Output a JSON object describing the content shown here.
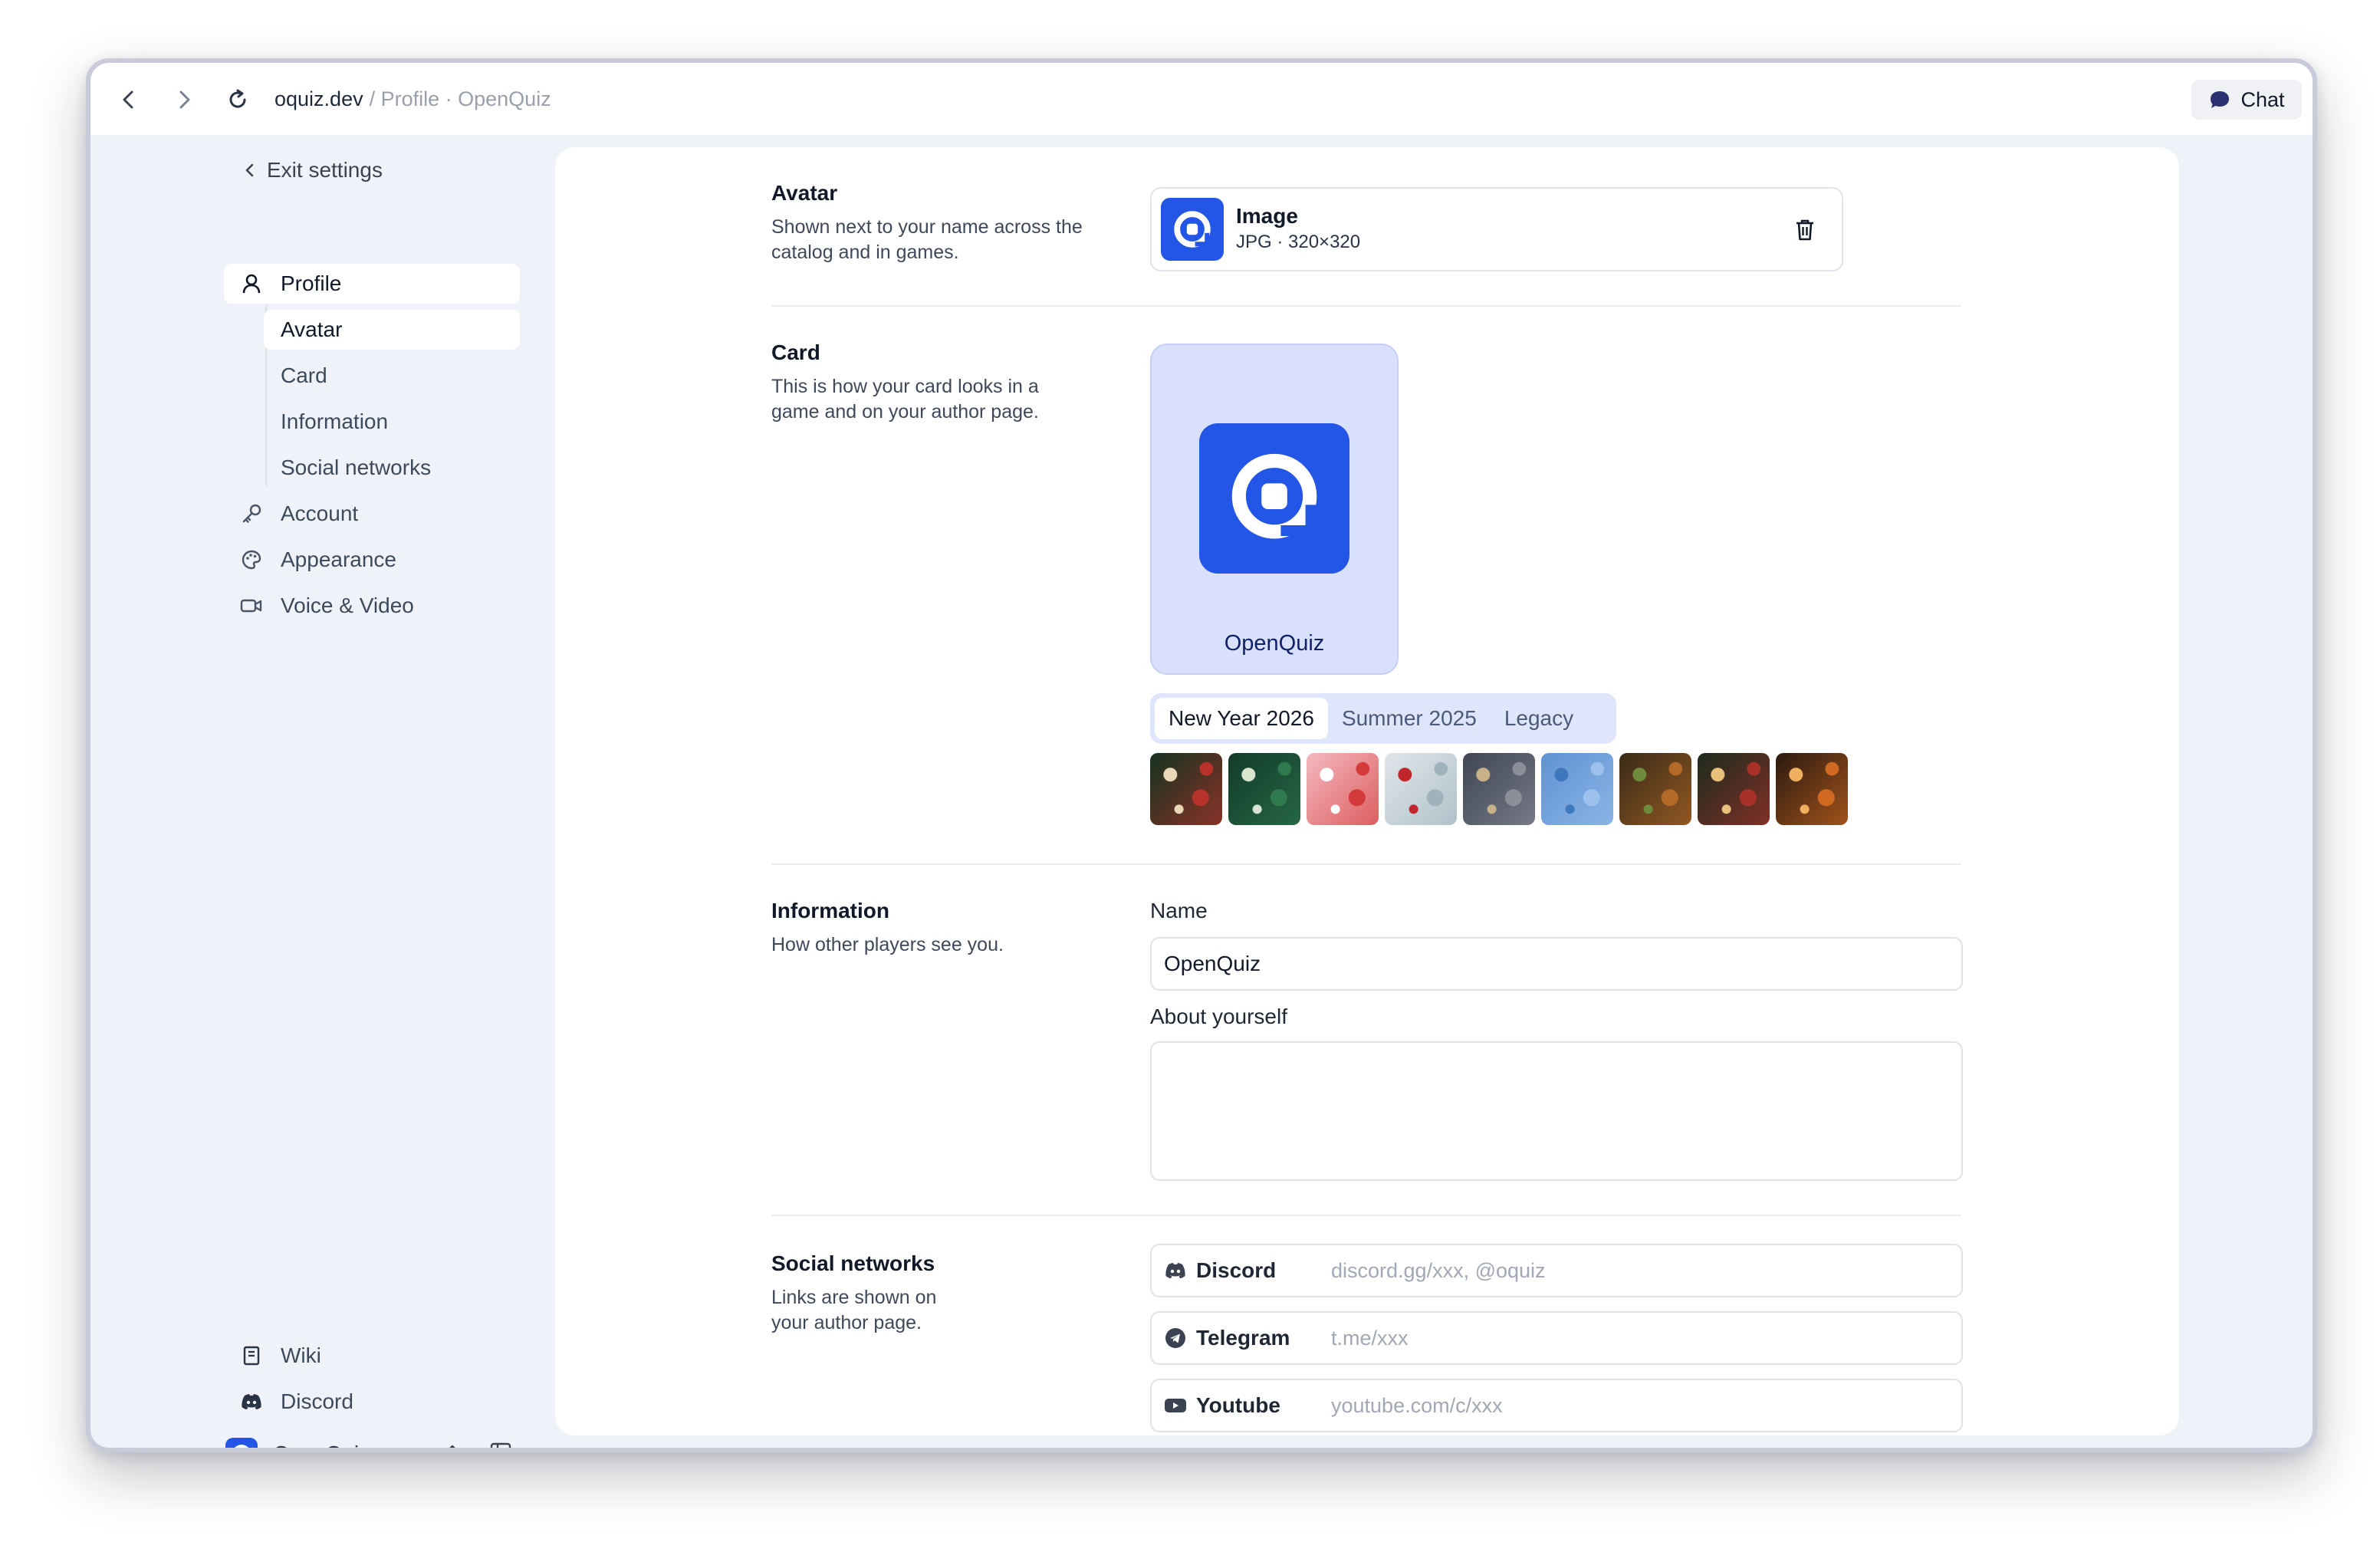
{
  "browser": {
    "host": "oquiz.dev",
    "path": "/ Profile · OpenQuiz",
    "chat_label": "Chat"
  },
  "sidebar": {
    "exit_label": "Exit settings",
    "items": [
      {
        "label": "Profile",
        "icon": "user-icon"
      },
      {
        "label": "Avatar"
      },
      {
        "label": "Card"
      },
      {
        "label": "Information"
      },
      {
        "label": "Social networks"
      },
      {
        "label": "Account",
        "icon": "key-icon"
      },
      {
        "label": "Appearance",
        "icon": "palette-icon"
      },
      {
        "label": "Voice & Video",
        "icon": "video-icon"
      }
    ],
    "bottom": {
      "wiki": "Wiki",
      "discord": "Discord",
      "workspace": "OpenQuiz"
    }
  },
  "avatar": {
    "title": "Avatar",
    "description": "Shown next to your name across the catalog and in games.",
    "file_name": "Image",
    "file_meta": "JPG · 320×320"
  },
  "card": {
    "title": "Card",
    "description": "This is how your card looks in a game and on your author page.",
    "preview_name": "OpenQuiz",
    "tabs": [
      "New Year 2026",
      "Summer 2025",
      "Legacy"
    ],
    "active_tab": "New Year 2026",
    "backgrounds": [
      {
        "name": "xmas-pattern-dark",
        "colors": [
          "#15321f",
          "#b8322c",
          "#e9d7b8"
        ]
      },
      {
        "name": "pine-trees-pattern",
        "colors": [
          "#123a2a",
          "#2f7a4f",
          "#d8e6d0"
        ]
      },
      {
        "name": "santa-pattern-pink",
        "colors": [
          "#f3b9bf",
          "#d43a3a",
          "#ffffff"
        ]
      },
      {
        "name": "winter-berries",
        "colors": [
          "#dfe6ea",
          "#9fb3bd",
          "#c0262b"
        ]
      },
      {
        "name": "frosty-branches",
        "colors": [
          "#3f4553",
          "#8b8f9a",
          "#c9b28a"
        ]
      },
      {
        "name": "blue-water",
        "colors": [
          "#5f93d3",
          "#9cc1ec",
          "#3f77bd"
        ]
      },
      {
        "name": "ornament-warm",
        "colors": [
          "#3a2a17",
          "#b36a28",
          "#6e8a3b"
        ]
      },
      {
        "name": "red-bauble-night",
        "colors": [
          "#1d2a1d",
          "#a8322a",
          "#e8c27a"
        ]
      },
      {
        "name": "orange-glow",
        "colors": [
          "#2b1a10",
          "#d06a20",
          "#f0b060"
        ]
      }
    ]
  },
  "information": {
    "title": "Information",
    "description": "How other players see you.",
    "name_label": "Name",
    "name_value": "OpenQuiz",
    "about_label": "About yourself",
    "about_value": ""
  },
  "social": {
    "title": "Social networks",
    "description": "Links are shown on your author page.",
    "items": [
      {
        "name": "Discord",
        "placeholder": "discord.gg/xxx, @oquiz",
        "icon": "discord-icon"
      },
      {
        "name": "Telegram",
        "placeholder": "t.me/xxx",
        "icon": "telegram-icon"
      },
      {
        "name": "Youtube",
        "placeholder": "youtube.com/c/xxx",
        "icon": "youtube-icon"
      }
    ]
  },
  "colors": {
    "accent": "#2355e6",
    "card_bg": "#d9e0fb",
    "panel_bg": "#eff2f8"
  }
}
